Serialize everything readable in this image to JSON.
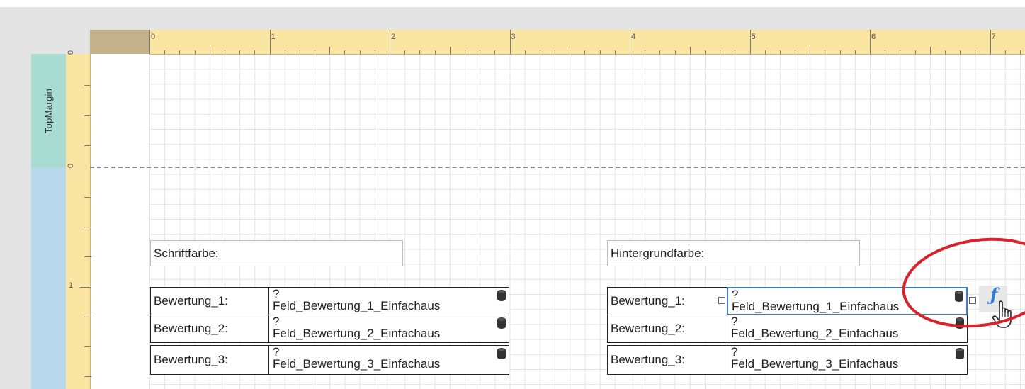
{
  "ruler": {
    "h_numbers": [
      "0",
      "1",
      "2",
      "3",
      "4",
      "5",
      "6",
      "7"
    ],
    "v_numbers_topmargin": [
      "0"
    ],
    "v_numbers_detail": [
      "0",
      "1"
    ]
  },
  "bands": {
    "topmargin": "TopMargin",
    "detail": ""
  },
  "report": {
    "left_header": "Schriftfarbe:",
    "right_header": "Hintergrundfarbe:",
    "rows": [
      {
        "label": "Bewertung_1:",
        "field_q": "?",
        "field_expr": "Feld_Bewertung_1_Einfachaus"
      },
      {
        "label": "Bewertung_2:",
        "field_q": "?",
        "field_expr": "Feld_Bewertung_2_Einfachaus"
      },
      {
        "label": "Bewertung_3:",
        "field_q": "?",
        "field_expr": "Feld_Bewertung_3_Einfachaus"
      }
    ]
  },
  "actions": {
    "fx_label": "ƒ"
  },
  "colors": {
    "accent_blue": "#3a7cc9",
    "annotation_red": "#d8232a",
    "ruler": "#fbe5a3",
    "topmargin_band": "#a8dcd2",
    "detail_band": "#b6d8ea"
  },
  "icons": [
    "database-icon",
    "fx-icon",
    "hand-cursor-icon"
  ]
}
